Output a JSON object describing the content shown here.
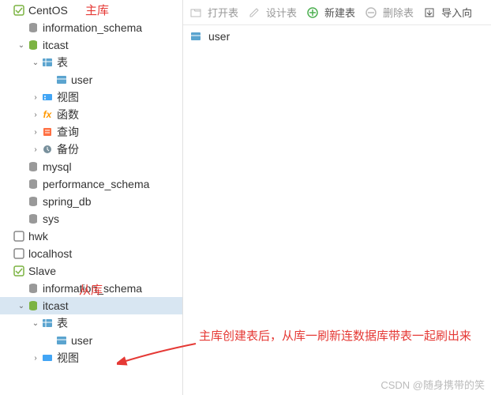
{
  "toolbar": {
    "open": "打开表",
    "design": "设计表",
    "new": "新建表",
    "delete": "删除表",
    "import": "导入向"
  },
  "content": {
    "table": "user"
  },
  "annotations": {
    "master": "主库",
    "slave": "从库",
    "note": "主库创建表后，从库一刷新连数据库带表一起刷出来"
  },
  "watermark": "CSDN @随身携带的笑",
  "tree": {
    "centos": "CentOS",
    "info_schema": "information_schema",
    "itcast": "itcast",
    "tables": "表",
    "user": "user",
    "views": "视图",
    "functions": "函数",
    "queries": "查询",
    "backups": "备份",
    "mysql": "mysql",
    "perf_schema": "performance_schema",
    "spring_db": "spring_db",
    "sys": "sys",
    "hwk": "hwk",
    "localhost": "localhost",
    "slave": "Slave"
  }
}
